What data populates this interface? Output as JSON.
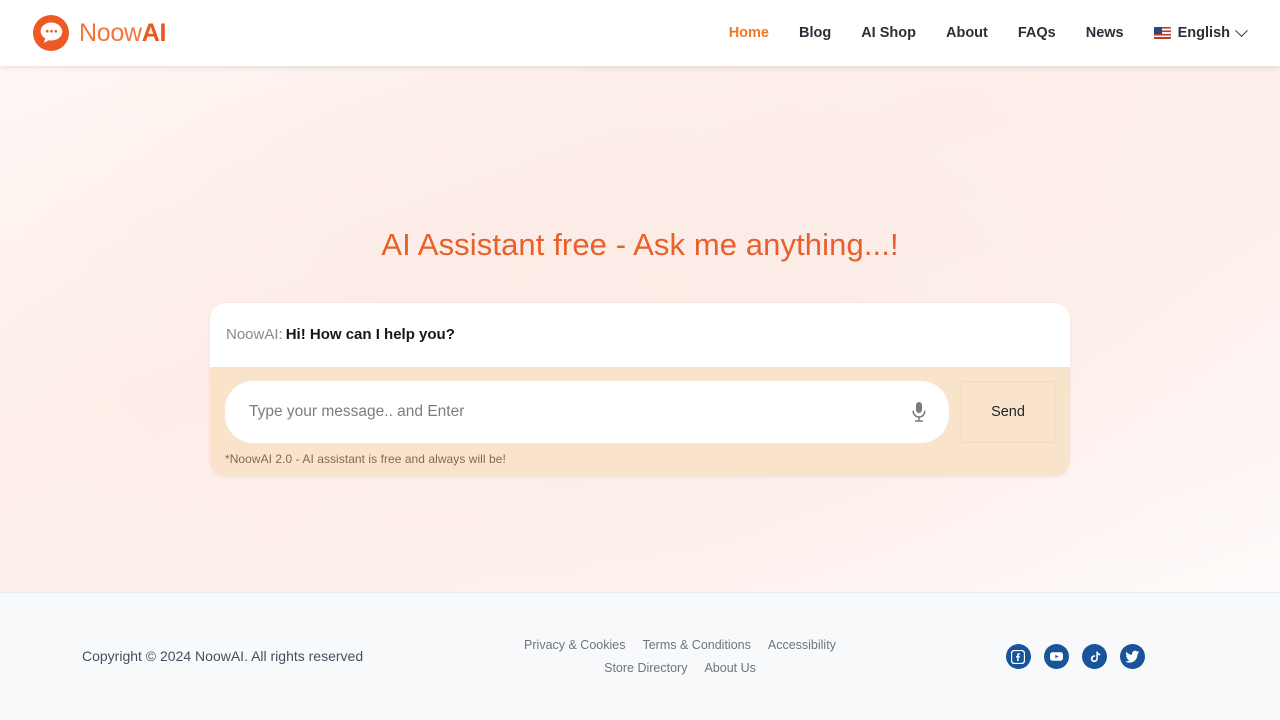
{
  "header": {
    "brand": {
      "name_light": "Noow",
      "name_bold": "AI",
      "logo_icon": "chat-bubble-logo-icon"
    },
    "nav": [
      {
        "label": "Home",
        "active": true
      },
      {
        "label": "Blog",
        "active": false
      },
      {
        "label": "AI Shop",
        "active": false
      },
      {
        "label": "About",
        "active": false
      },
      {
        "label": "FAQs",
        "active": false
      },
      {
        "label": "News",
        "active": false
      }
    ],
    "language": {
      "label": "English",
      "flag": "us-flag-icon",
      "chevron": "chevron-down-icon"
    }
  },
  "main": {
    "hero_title": "AI Assistant free - Ask me anything...!",
    "chat": {
      "speaker": "NoowAI:",
      "message": "Hi! How can I help you?"
    },
    "composer": {
      "input_value": "",
      "input_placeholder": "Type your message.. and Enter",
      "mic_icon": "microphone-icon",
      "send_label": "Send",
      "note": "*NoowAI 2.0 - AI assistant is free and always will be!"
    }
  },
  "footer": {
    "copyright": "Copyright © 2024 NoowAI. All rights reserved",
    "links_row1": [
      {
        "label": "Privacy & Cookies"
      },
      {
        "label": "Terms & Conditions"
      },
      {
        "label": "Accessibility"
      }
    ],
    "links_row2": [
      {
        "label": "Store Directory"
      },
      {
        "label": "About Us"
      }
    ],
    "social": [
      {
        "name": "facebook-icon"
      },
      {
        "name": "youtube-icon"
      },
      {
        "name": "tiktok-icon"
      },
      {
        "name": "twitter-icon"
      }
    ]
  },
  "colors": {
    "brand_orange": "#e8581f",
    "brand_orange_light": "#f4743b",
    "hero_orange": "#e8602a",
    "composer_peach": "#fae3cb",
    "social_blue": "#19549a",
    "footer_bg": "#f8f9fb"
  }
}
